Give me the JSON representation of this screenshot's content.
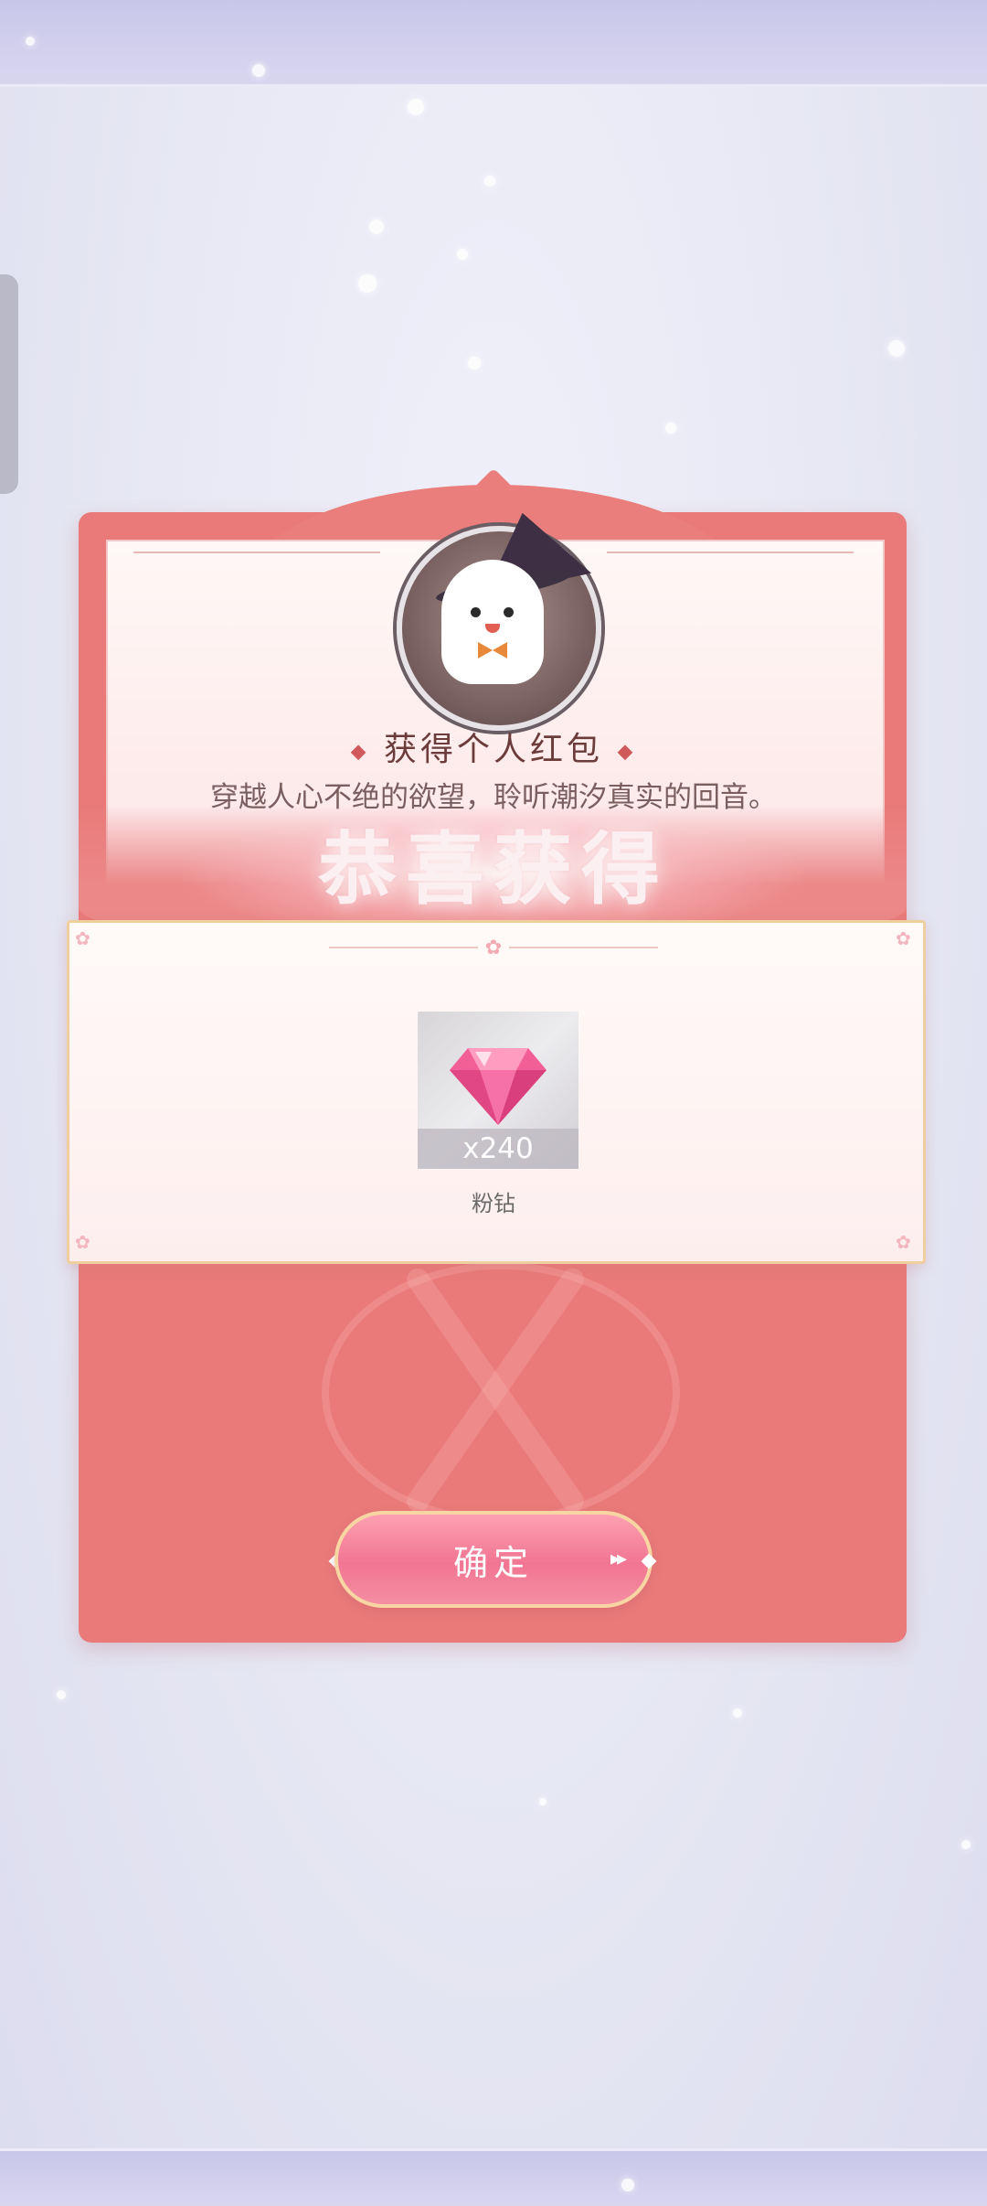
{
  "dialog": {
    "title": "获得个人红包",
    "message": "穿越人心不绝的欲望，聆听潮汐真实的回音。",
    "banner": "恭喜获得"
  },
  "reward": {
    "icon": "pink-diamond-icon",
    "quantity": "x240",
    "name": "粉钻"
  },
  "actions": {
    "confirm_label": "确定"
  },
  "colors": {
    "envelope": "#e97a79",
    "card_border": "#f0cf9f",
    "button": "#f17592"
  }
}
